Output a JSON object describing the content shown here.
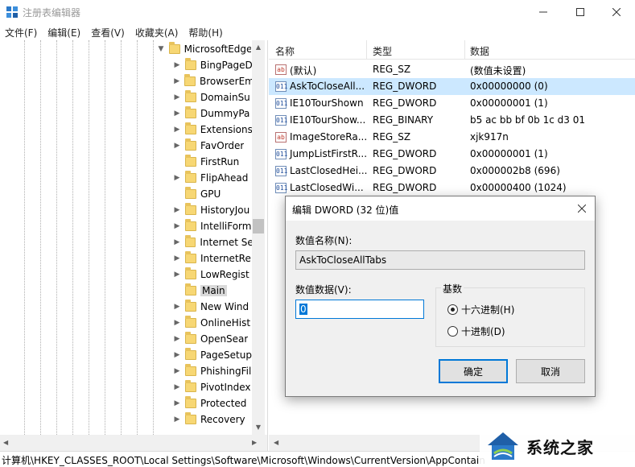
{
  "window": {
    "title": "注册表编辑器"
  },
  "menu": [
    "文件(F)",
    "编辑(E)",
    "查看(V)",
    "收藏夹(A)",
    "帮助(H)"
  ],
  "tree": {
    "parent": "MicrosoftEdge",
    "items": [
      "BingPageD",
      "BrowserEm",
      "DomainSu",
      "DummyPa",
      "Extensions",
      "FavOrder",
      "FirstRun",
      "FlipAhead",
      "GPU",
      "HistoryJou",
      "IntelliForm",
      "Internet Se",
      "InternetRe",
      "LowRegist",
      "Main",
      "New Wind",
      "OnlineHist",
      "OpenSear",
      "PageSetup",
      "PhishingFil",
      "PivotIndex",
      "Protected",
      "Recovery"
    ],
    "selected_index": 14
  },
  "list": {
    "headers": {
      "name": "名称",
      "type": "类型",
      "data": "数据"
    },
    "rows": [
      {
        "icon": "ab",
        "name": "(默认)",
        "type": "REG_SZ",
        "data": "(数值未设置)"
      },
      {
        "icon": "bin",
        "name": "AskToCloseAll...",
        "type": "REG_DWORD",
        "data": "0x00000000 (0)"
      },
      {
        "icon": "bin",
        "name": "IE10TourShown",
        "type": "REG_DWORD",
        "data": "0x00000001 (1)"
      },
      {
        "icon": "bin",
        "name": "IE10TourShow...",
        "type": "REG_BINARY",
        "data": "b5 ac bb bf 0b 1c d3 01"
      },
      {
        "icon": "ab",
        "name": "ImageStoreRa...",
        "type": "REG_SZ",
        "data": "xjk917n"
      },
      {
        "icon": "bin",
        "name": "JumpListFirstR...",
        "type": "REG_DWORD",
        "data": "0x00000001 (1)"
      },
      {
        "icon": "bin",
        "name": "LastClosedHei...",
        "type": "REG_DWORD",
        "data": "0x000002b8 (696)"
      },
      {
        "icon": "bin",
        "name": "LastClosedWi...",
        "type": "REG_DWORD",
        "data": "0x00000400 (1024)"
      }
    ],
    "selected_index": 1
  },
  "status": {
    "path": "计算机\\HKEY_CLASSES_ROOT\\Local Settings\\Software\\Microsoft\\Windows\\CurrentVersion\\AppContain"
  },
  "dialog": {
    "title": "编辑 DWORD (32 位)值",
    "name_label": "数值名称(N):",
    "name_value": "AskToCloseAllTabs",
    "data_label": "数值数据(V):",
    "data_value": "0",
    "base_label": "基数",
    "hex_label": "十六进制(H)",
    "dec_label": "十进制(D)",
    "base_selected": "hex",
    "ok_label": "确定",
    "cancel_label": "取消"
  },
  "watermark": {
    "text": "系统之家"
  },
  "colors": {
    "selection": "#cce8ff",
    "accent": "#0078d7",
    "folder": "#f7d774"
  }
}
